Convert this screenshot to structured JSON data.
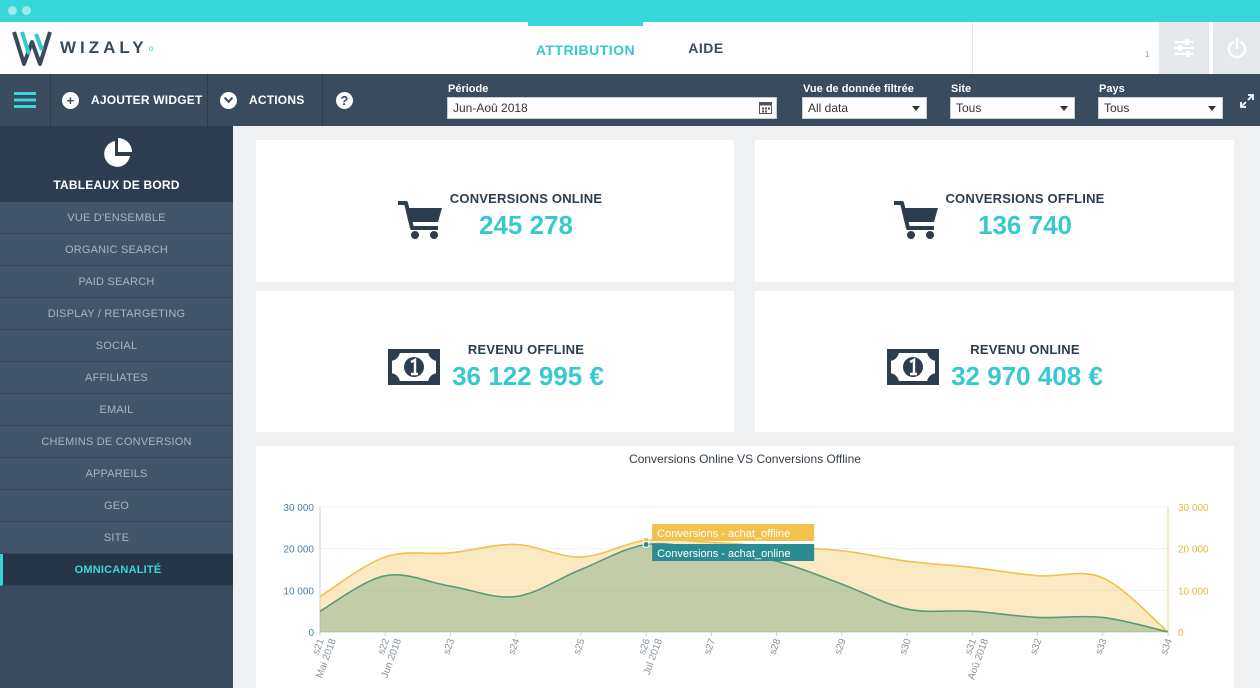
{
  "app": {
    "brand": "WIZALY",
    "nav_tabs": [
      "ATTRIBUTION",
      "AIDE"
    ],
    "active_tab": "ATTRIBUTION",
    "top_small": "1"
  },
  "toolbar": {
    "add_widget": "AJOUTER WIDGET",
    "actions": "ACTIONS",
    "help_glyph": "?",
    "period_label": "Période",
    "period_value": "Jun-Aoû 2018",
    "view_label": "Vue de donnée filtrée",
    "view_value": "All data",
    "site_label": "Site",
    "site_value": "Tous",
    "country_label": "Pays",
    "country_value": "Tous"
  },
  "sidebar": {
    "title": "TABLEAUX DE BORD",
    "items": [
      {
        "label": "VUE D'ENSEMBLE"
      },
      {
        "label": "ORGANIC SEARCH"
      },
      {
        "label": "PAID SEARCH"
      },
      {
        "label": "DISPLAY / RETARGETING"
      },
      {
        "label": "SOCIAL"
      },
      {
        "label": "AFFILIATES"
      },
      {
        "label": "EMAIL"
      },
      {
        "label": "CHEMINS DE CONVERSION"
      },
      {
        "label": "APPAREILS"
      },
      {
        "label": "GEO"
      },
      {
        "label": "SITE"
      },
      {
        "label": "OMNICANALITÉ"
      }
    ],
    "active_item": "OMNICANALITÉ"
  },
  "kpis": [
    {
      "label": "CONVERSIONS ONLINE",
      "value": "245 278",
      "icon": "cart-icon"
    },
    {
      "label": "CONVERSIONS OFFLINE",
      "value": "136 740",
      "icon": "cart-icon"
    },
    {
      "label": "REVENU OFFLINE",
      "value": "36 122 995 €",
      "icon": "banknote-icon"
    },
    {
      "label": "REVENU ONLINE",
      "value": "32 970 408 €",
      "icon": "banknote-icon"
    }
  ],
  "colors": {
    "accent": "#38d6d8",
    "navy": "#3a4b5d",
    "offline": "#f2c14e",
    "online": "#5a9a7a",
    "online_tip": "#2b8c94"
  },
  "chart_data": {
    "type": "area",
    "title": "Conversions Online VS Conversions Offline",
    "x": [
      "s21",
      "s22",
      "s23",
      "s24",
      "s25",
      "s26",
      "s27",
      "s28",
      "s29",
      "s30",
      "s31",
      "s32",
      "s33",
      "s34"
    ],
    "x_sublabels": [
      "Mai 2018",
      "Jun 2018",
      "",
      "",
      "",
      "Jul 2018",
      "",
      "",
      "",
      "",
      "Aoû 2018",
      "",
      "",
      ""
    ],
    "series": [
      {
        "name": "Conversions - achat_offline",
        "values": [
          8500,
          18000,
          19000,
          21000,
          18000,
          22000,
          21500,
          20500,
          19500,
          17000,
          15500,
          13500,
          13000,
          0
        ]
      },
      {
        "name": "Conversions - achat_online",
        "values": [
          5000,
          13500,
          11000,
          8500,
          15000,
          21000,
          19500,
          17000,
          11500,
          5500,
          5000,
          3500,
          3500,
          0
        ]
      }
    ],
    "ylim": [
      0,
      30000
    ],
    "yticks": [
      "0",
      "10 000",
      "20 000",
      "30 000"
    ],
    "tooltip_x": "s26"
  }
}
